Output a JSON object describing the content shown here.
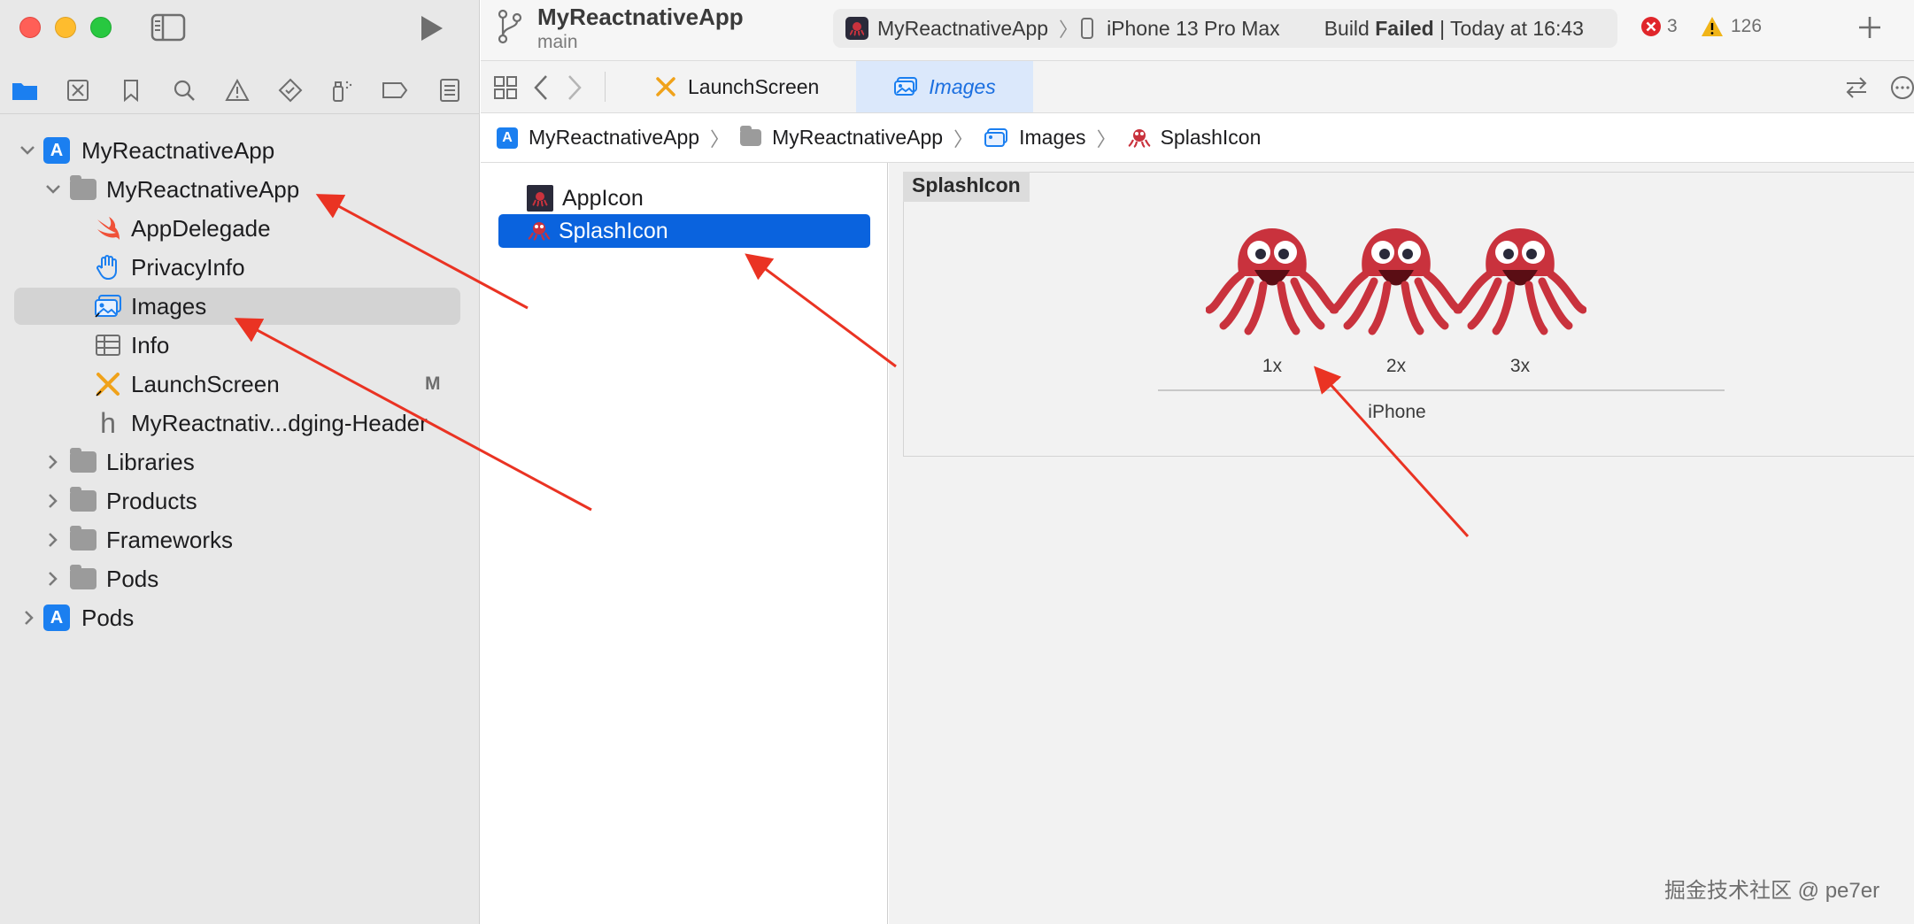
{
  "window": {
    "project_title": "MyReactnativeApp",
    "branch": "main"
  },
  "toolbar": {
    "scheme": "MyReactnativeApp",
    "destination": "iPhone 13 Pro Max",
    "status_prefix": "Build ",
    "status_bold": "Failed",
    "status_suffix": " | Today at 16:43",
    "error_count": "3",
    "warning_count": "126"
  },
  "tabs": [
    {
      "label": "LaunchScreen"
    },
    {
      "label": "Images"
    }
  ],
  "breadcrumb": [
    "MyReactnativeApp",
    "MyReactnativeApp",
    "Images",
    "SplashIcon"
  ],
  "navigator": {
    "items": [
      {
        "label": "MyReactnativeApp"
      },
      {
        "label": "MyReactnativeApp"
      },
      {
        "label": "AppDelegade"
      },
      {
        "label": "PrivacyInfo"
      },
      {
        "label": "Images"
      },
      {
        "label": "Info"
      },
      {
        "label": "LaunchScreen",
        "badge": "M"
      },
      {
        "label": "MyReactnativ...dging-Header"
      },
      {
        "label": "Libraries"
      },
      {
        "label": "Products"
      },
      {
        "label": "Frameworks"
      },
      {
        "label": "Pods"
      },
      {
        "label": "Pods"
      }
    ]
  },
  "assets": [
    {
      "label": "AppIcon"
    },
    {
      "label": "SplashIcon"
    }
  ],
  "image_set": {
    "name": "SplashIcon",
    "slots": [
      "1x",
      "2x",
      "3x"
    ],
    "device": "iPhone"
  },
  "watermark": "掘金技术社区 @ pe7er",
  "colors": {
    "selection": "#0a63de",
    "accent": "#1b7ff0",
    "arrow": "#ea3323",
    "error": "#e0262b",
    "warning": "#f0b418"
  },
  "icons": [
    "sidebar-toggle-icon",
    "run-icon",
    "branch-icon",
    "plus-icon",
    "folder-icon",
    "swift-icon",
    "hand-icon",
    "asset-catalog-icon",
    "table-icon",
    "interface-builder-icon",
    "header-file-icon",
    "octopus-icon"
  ]
}
